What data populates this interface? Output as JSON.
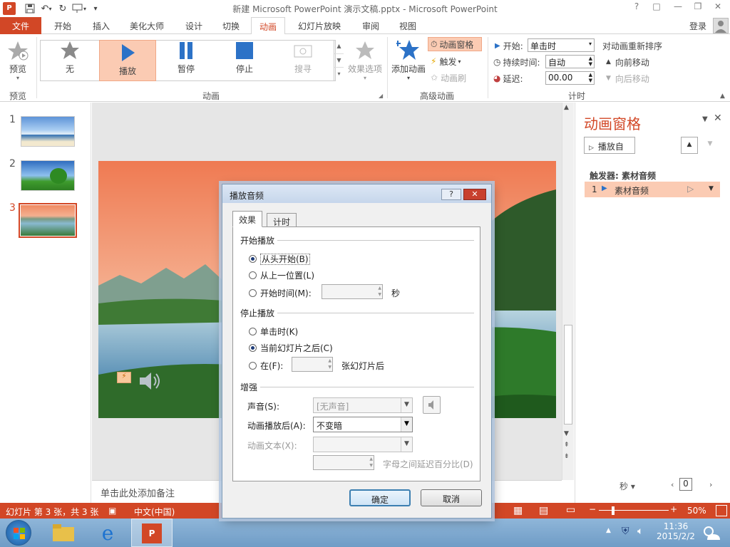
{
  "window": {
    "title": "新建 Microsoft PowerPoint 演示文稿.pptx - Microsoft PowerPoint",
    "controls": [
      "?",
      "□",
      "—",
      "❐",
      "✕"
    ]
  },
  "tabs": {
    "file": "文件",
    "items": [
      "开始",
      "插入",
      "美化大师",
      "设计",
      "切换",
      "动画",
      "幻灯片放映",
      "审阅",
      "视图"
    ],
    "active": "动画",
    "login": "登录"
  },
  "ribbon": {
    "preview": {
      "label": "预览",
      "group": "预览"
    },
    "effects": [
      {
        "label": "无",
        "icon": "star-gray-icon"
      },
      {
        "label": "播放",
        "icon": "play-icon",
        "selected": true
      },
      {
        "label": "暂停",
        "icon": "pause-icon"
      },
      {
        "label": "停止",
        "icon": "stop-icon"
      },
      {
        "label": "搜寻",
        "icon": "seek-icon",
        "disabled": true
      }
    ],
    "effect_options": "效果选项",
    "group_animation": "动画",
    "add_animation": "添加动画",
    "animation_pane": "动画窗格",
    "trigger": "触发",
    "animation_painter": "动画刷",
    "group_advanced": "高级动画",
    "start_label": "开始:",
    "start_value": "单击时",
    "duration_label": "持续时间:",
    "duration_value": "自动",
    "delay_label": "延迟:",
    "delay_value": "00.00",
    "group_timing": "计时",
    "reorder_title": "对动画重新排序",
    "move_earlier": "向前移动",
    "move_later": "向后移动"
  },
  "slides": [
    {
      "number": "1"
    },
    {
      "number": "2"
    },
    {
      "number": "3",
      "selected": true
    }
  ],
  "notes_placeholder": "单击此处添加备注",
  "anim_pane": {
    "title": "动画窗格",
    "play_from": "播放自",
    "trigger_label": "触发器: 素材音频",
    "item_index": "1",
    "item_name": "素材音频",
    "seconds": "秒",
    "zoom_field": "0"
  },
  "status": {
    "slide_info": "幻灯片 第 3 张，共 3 张",
    "language": "中文(中国)",
    "zoom": "50%"
  },
  "taskbar": {
    "time": "11:36",
    "date": "2015/2/2"
  },
  "dialog": {
    "title": "播放音频",
    "help": "?",
    "close": "✕",
    "tab_effect": "效果",
    "tab_timing": "计时",
    "start_section": "开始播放",
    "opt_from_start": "从头开始(B)",
    "opt_from_last": "从上一位置(L)",
    "opt_start_time": "开始时间(M):",
    "start_time_unit": "秒",
    "stop_section": "停止播放",
    "opt_on_click": "单击时(K)",
    "opt_after_current": "当前幻灯片之后(C)",
    "opt_after": "在(F):",
    "after_unit": "张幻灯片后",
    "enhance_section": "增强",
    "sound_label": "声音(S):",
    "sound_value": "[无声音]",
    "after_anim_label": "动画播放后(A):",
    "after_anim_value": "不变暗",
    "anim_text_label": "动画文本(X):",
    "letter_delay_label": "字母之间延迟百分比(D)",
    "ok": "确定",
    "cancel": "取消"
  },
  "colors": {
    "accent": "#d24726",
    "selected_fill": "#fbcbb3"
  }
}
